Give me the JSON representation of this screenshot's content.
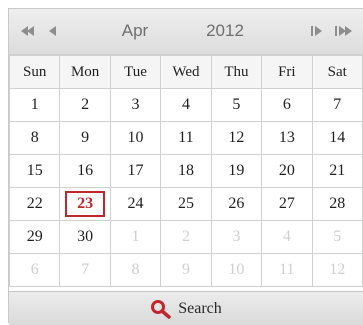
{
  "header": {
    "month": "Apr",
    "year": "2012",
    "prev_year_icon": "double-left-arrow",
    "prev_month_icon": "left-arrow",
    "next_month_icon": "right-arrow",
    "next_year_icon": "double-right-arrow"
  },
  "weekdays": [
    "Sun",
    "Mon",
    "Tue",
    "Wed",
    "Thu",
    "Fri",
    "Sat"
  ],
  "weeks": [
    [
      "1",
      "2",
      "3",
      "4",
      "5",
      "6",
      "7"
    ],
    [
      "8",
      "9",
      "10",
      "11",
      "12",
      "13",
      "14"
    ],
    [
      "15",
      "16",
      "17",
      "18",
      "19",
      "20",
      "21"
    ],
    [
      "22",
      "23",
      "24",
      "25",
      "26",
      "27",
      "28"
    ],
    [
      "29",
      "30",
      "1",
      "2",
      "3",
      "4",
      "5"
    ],
    [
      "6",
      "7",
      "8",
      "9",
      "10",
      "11",
      "12"
    ]
  ],
  "today": "23",
  "footer": {
    "search_label": "Search",
    "search_icon": "magnifier-icon"
  },
  "colors": {
    "today": "#c0262b",
    "muted": "#cfcfcf",
    "search_icon": "#c0262b"
  }
}
